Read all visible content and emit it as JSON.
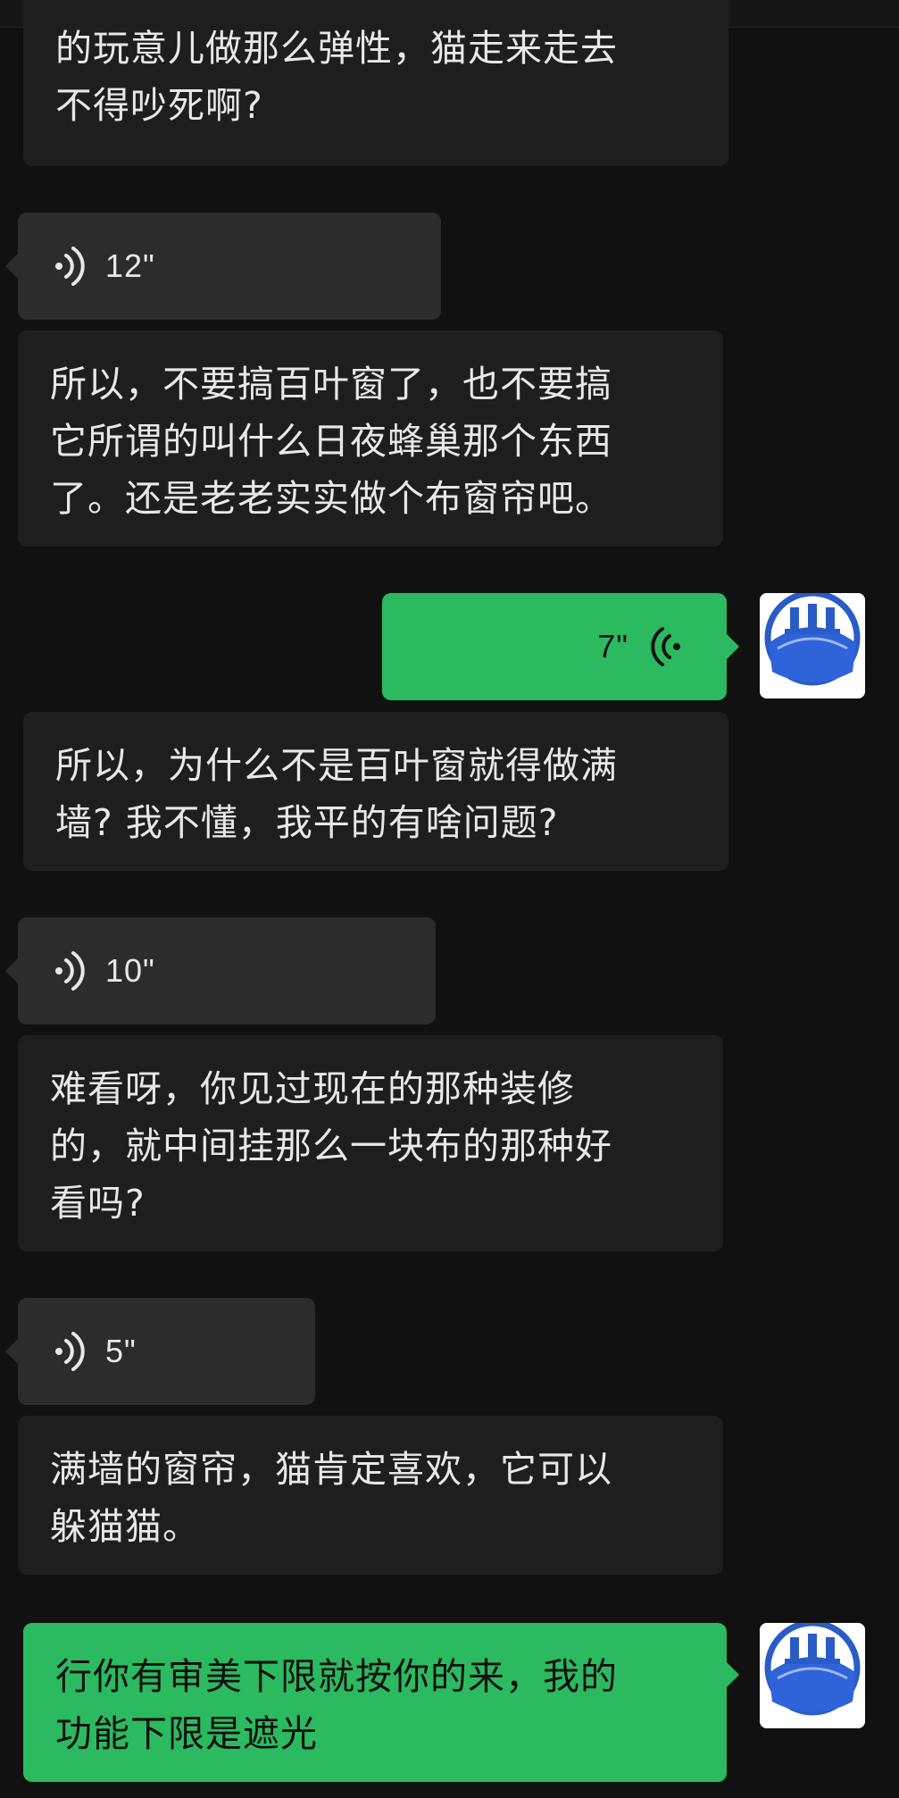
{
  "chat": {
    "messages": [
      {
        "side": "in",
        "type": "text",
        "text": "的玩意儿做那么弹性，猫走来走去\n不得吵死啊?"
      },
      {
        "side": "in",
        "type": "voice",
        "duration": "12\""
      },
      {
        "side": "in",
        "type": "text",
        "text": "所以，不要搞百叶窗了，也不要搞\n它所谓的叫什么日夜蜂巢那个东西\n了。还是老老实实做个布窗帘吧。"
      },
      {
        "side": "out",
        "type": "voice",
        "duration": "7\""
      },
      {
        "side": "in",
        "type": "text",
        "text": "所以，为什么不是百叶窗就得做满\n墙? 我不懂，我平的有啥问题?"
      },
      {
        "side": "in",
        "type": "voice",
        "duration": "10\""
      },
      {
        "side": "in",
        "type": "text",
        "text": "难看呀，你见过现在的那种装修\n的，就中间挂那么一块布的那种好\n看吗?"
      },
      {
        "side": "in",
        "type": "voice",
        "duration": "5\""
      },
      {
        "side": "in",
        "type": "text",
        "text": "满墙的窗帘，猫肯定喜欢，它可以\n躲猫猫。"
      },
      {
        "side": "out",
        "type": "text",
        "text": "行你有审美下限就按你的来，我的\n功能下限是遮光"
      }
    ]
  },
  "colors": {
    "background": "#111111",
    "incoming_text_bubble": "#1e1e1e",
    "incoming_voice_bubble": "#2c2c2c",
    "outgoing_bubble": "#2bba5f",
    "incoming_text": "#e8e8e8",
    "outgoing_text": "#101010"
  },
  "icons": {
    "voice_in": "voice-wave-icon",
    "voice_out": "voice-wave-icon",
    "avatar": "mask-avatar"
  }
}
